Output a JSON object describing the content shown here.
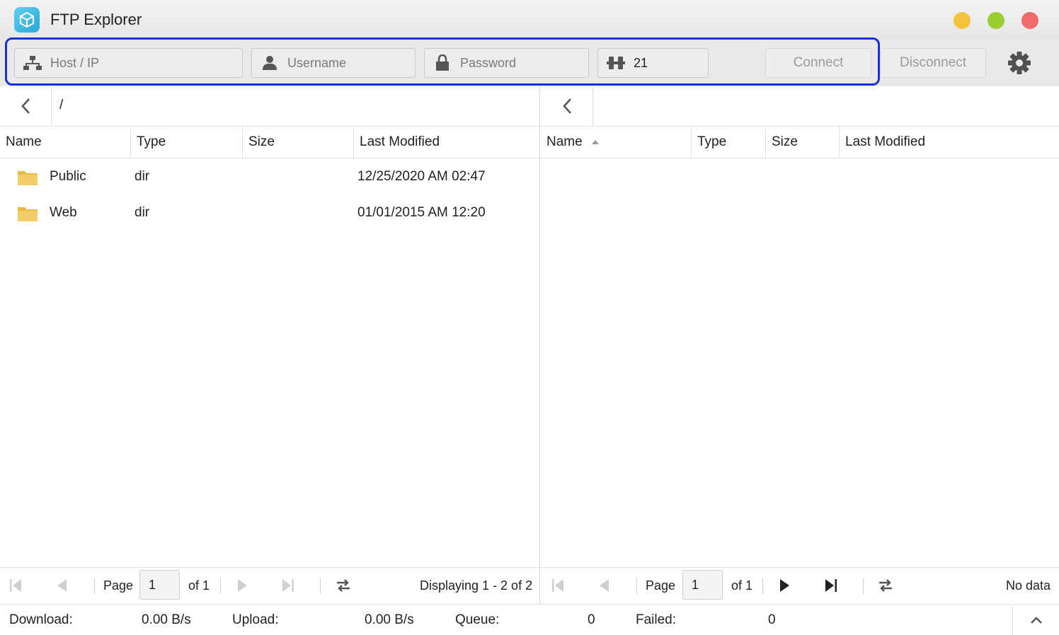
{
  "window": {
    "title": "FTP Explorer"
  },
  "connection": {
    "host_placeholder": "Host / IP",
    "username_placeholder": "Username",
    "password_placeholder": "Password",
    "port_value": "21",
    "connect_label": "Connect",
    "disconnect_label": "Disconnect"
  },
  "left_panel": {
    "path": "/",
    "columns": [
      "Name",
      "Type",
      "Size",
      "Last Modified"
    ],
    "rows": [
      {
        "name": "Public",
        "type": "dir",
        "size": "",
        "modified": "12/25/2020 AM 02:47"
      },
      {
        "name": "Web",
        "type": "dir",
        "size": "",
        "modified": "01/01/2015 AM 12:20"
      }
    ],
    "pager": {
      "page_label": "Page",
      "page": "1",
      "of_label": "of 1",
      "display": "Displaying 1 - 2 of 2"
    }
  },
  "right_panel": {
    "path": "",
    "columns": [
      "Name",
      "Type",
      "Size",
      "Last Modified"
    ],
    "sort": "Name ascending",
    "pager": {
      "page_label": "Page",
      "page": "1",
      "of_label": "of 1",
      "display": "No data"
    }
  },
  "status": {
    "download_label": "Download:",
    "download_value": "0.00 B/s",
    "upload_label": "Upload:",
    "upload_value": "0.00 B/s",
    "queue_label": "Queue:",
    "queue_value": "0",
    "failed_label": "Failed:",
    "failed_value": "0"
  },
  "colors": {
    "highlight": "#1a2fe0",
    "folder": "#f3cd66"
  }
}
